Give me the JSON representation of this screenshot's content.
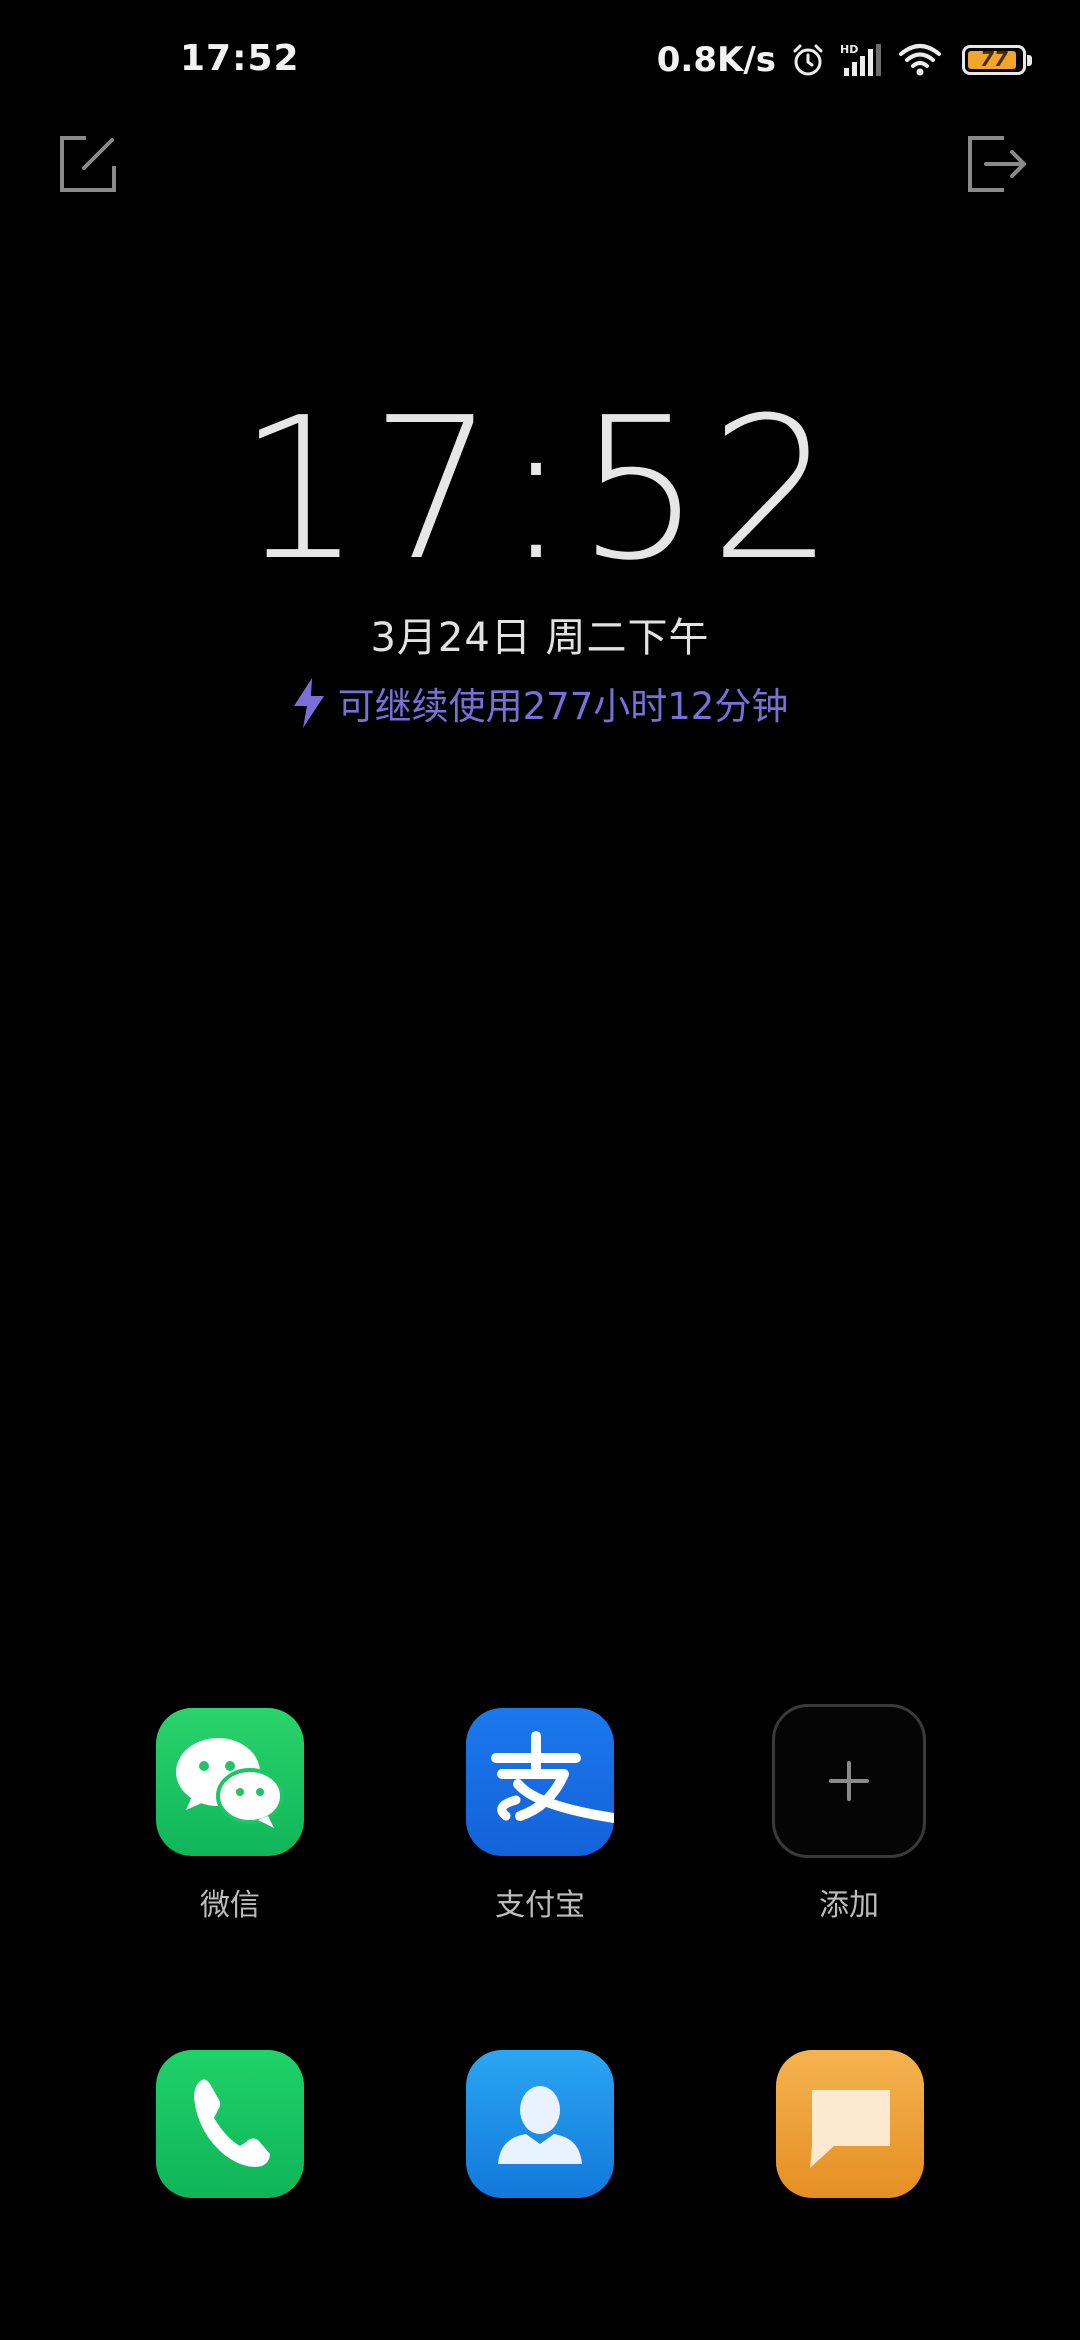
{
  "status_bar": {
    "time": "17:52",
    "net_speed": "0.8K/s",
    "battery_level": "77",
    "icons": [
      "alarm-icon",
      "hd-signal-icon",
      "wifi-icon",
      "battery-icon"
    ]
  },
  "top_actions": {
    "left_icon": "edit-note-icon",
    "right_icon": "exit-icon"
  },
  "clock": {
    "time": "17:52",
    "date": "3月24日 周二下午"
  },
  "battery_info": {
    "text": "可继续使用277小时12分钟",
    "color": "#7c6ed8"
  },
  "shortcuts": [
    {
      "label": "微信",
      "icon": "wechat-icon",
      "color": "#1fc564"
    },
    {
      "label": "支付宝",
      "icon": "alipay-icon",
      "color": "#1a6fe6"
    },
    {
      "label": "添加",
      "icon": "plus-icon",
      "color": "#3a3a3a"
    }
  ],
  "dock": [
    {
      "icon": "phone-icon",
      "color": "#1ac463"
    },
    {
      "icon": "contacts-icon",
      "color": "#1f8fe8"
    },
    {
      "icon": "messages-icon",
      "color": "#eea03a"
    }
  ]
}
